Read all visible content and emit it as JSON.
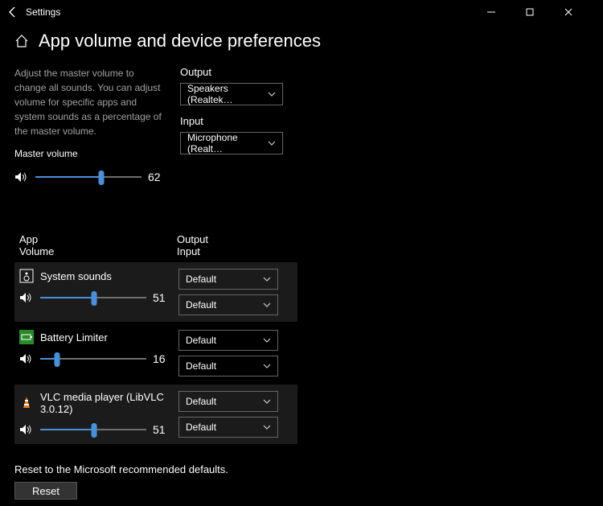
{
  "window": {
    "title": "Settings"
  },
  "header": {
    "title": "App volume and device preferences"
  },
  "description": "Adjust the master volume to change all sounds. You can adjust volume for specific apps and system sounds as a percentage of the master volume.",
  "master": {
    "label": "Master volume",
    "value": 62
  },
  "output": {
    "label": "Output",
    "selected": "Speakers (Realtek…"
  },
  "input": {
    "label": "Input",
    "selected": "Microphone (Realt…"
  },
  "table": {
    "head_app": "App",
    "head_vol": "Volume",
    "head_out": "Output",
    "head_in": "Input"
  },
  "apps": [
    {
      "name": "System sounds",
      "icon": "speaker-box",
      "volume": 51,
      "output": "Default",
      "input": "Default"
    },
    {
      "name": "Battery Limiter",
      "icon": "battery",
      "volume": 16,
      "output": "Default",
      "input": "Default"
    },
    {
      "name": "VLC media player (LibVLC 3.0.12)",
      "icon": "vlc",
      "volume": 51,
      "output": "Default",
      "input": "Default"
    }
  ],
  "reset": {
    "text": "Reset to the Microsoft recommended defaults.",
    "button": "Reset"
  }
}
